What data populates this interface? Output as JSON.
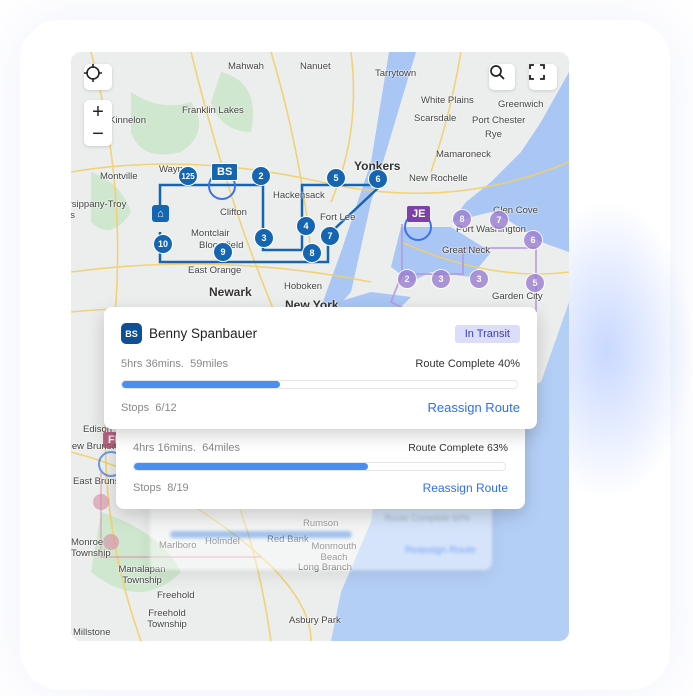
{
  "map": {
    "controls": {
      "locate_icon": "crosshair-icon",
      "zoom_in": "+",
      "zoom_out": "−",
      "search_icon": "zoom-search-icon",
      "fullscreen_icon": "fullscreen-icon"
    },
    "places": [
      "Mahwah",
      "Nanuet",
      "Tarrytown",
      "White Plains",
      "Greenwich",
      "Franklin Lakes",
      "Kinnelon",
      "Scarsdale",
      "Port Chester",
      "Rye",
      "Mamaroneck",
      "Montville",
      "Wayne",
      "Yonkers",
      "New Rochelle",
      "Hackensack",
      "Parsippany-Troy Hills",
      "Clifton",
      "Fort Lee",
      "Glen Cove",
      "Port Washington",
      "Montclair",
      "Bloomfield",
      "Great Neck",
      "East Orange",
      "Newark",
      "Hoboken",
      "New York",
      "Garden City",
      "Edison",
      "New Brunswick",
      "East Brunswick",
      "Monroe Township",
      "Rumson",
      "Holmdel",
      "Red Bank",
      "Marlboro",
      "Monmouth Beach",
      "Long Branch",
      "Manalapan Township",
      "Freehold",
      "Freehold Township",
      "Asbury Park",
      "Millstone"
    ],
    "route_markers": {
      "driver": "BS",
      "stops": [
        "125",
        "2",
        "5",
        "6",
        "10",
        "9",
        "3",
        "4",
        "8",
        "7"
      ]
    },
    "other_route": {
      "driver": "JE",
      "stops": [
        "8",
        "7",
        "6",
        "2",
        "3",
        "3",
        "5"
      ]
    },
    "other_driver_partial": "FD",
    "route_color": "#1565b0",
    "other_route_color": "#9b7ed0"
  },
  "cards": [
    {
      "initials": "BS",
      "name": "Benny Spanbauer",
      "status": "In Transit",
      "duration": "5hrs 36mins.",
      "distance": "59miles",
      "complete_label": "Route Complete",
      "complete_pct": "40%",
      "progress": 40,
      "stops_label": "Stops",
      "stops": "6/12",
      "action": "Reassign Route"
    },
    {
      "duration": "4hrs 16mins.",
      "distance": "64miles",
      "complete_label": "Route Complete",
      "complete_pct": "63%",
      "progress": 63,
      "stops_label": "Stops",
      "stops": "8/19",
      "action": "Reassign Route"
    },
    {
      "complete_label": "Route Complete 60%",
      "action": "Reassign Route",
      "progress": 60
    }
  ]
}
